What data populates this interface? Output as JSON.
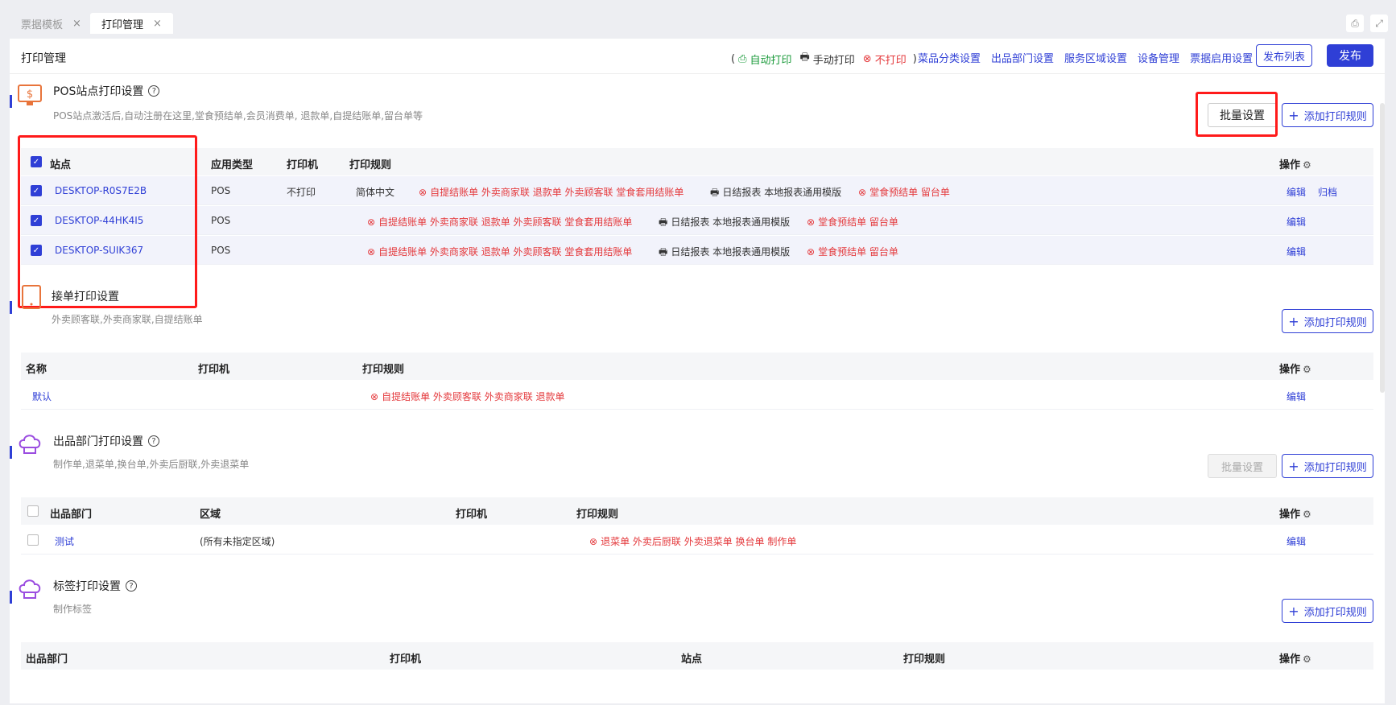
{
  "tabs": [
    {
      "label": "票据模板",
      "close": "×"
    },
    {
      "label": "打印管理",
      "close": "×"
    }
  ],
  "header": {
    "title": "打印管理",
    "legend": {
      "open": "(",
      "auto": "自动打印",
      "manual": "手动打印",
      "none": "不打印",
      "close": ")"
    },
    "links": [
      "菜品分类设置",
      "出品部门设置",
      "服务区域设置",
      "设备管理",
      "票据启用设置"
    ],
    "publish_list": "发布列表",
    "publish": "发布"
  },
  "pos": {
    "title": "POS站点打印设置",
    "desc": "POS站点激活后,自动注册在这里,堂食预结单,会员消费单, 退款单,自提结账单,留台单等",
    "batch": "批量设置",
    "add_rule": "添加打印规则",
    "columns": [
      "站点",
      "应用类型",
      "打印机",
      "打印规则",
      "操作"
    ],
    "rows": [
      {
        "site": "DESKTOP-R0S7E2B",
        "type": "POS",
        "printer": "不打印",
        "lang": "简体中文",
        "rule1": "自提结账单 外卖商家联 退款单 外卖顾客联 堂食套用结账单",
        "rule2": "日结报表 本地报表通用模版",
        "rule3": "堂食预结单 留台单",
        "edit": "编辑",
        "archive": "归档"
      },
      {
        "site": "DESKTOP-44HK4I5",
        "type": "POS",
        "printer": "",
        "lang": "",
        "rule1": "自提结账单 外卖商家联 退款单 外卖顾客联 堂食套用结账单",
        "rule2": "日结报表 本地报表通用模版",
        "rule3": "堂食预结单 留台单",
        "edit": "编辑",
        "archive": ""
      },
      {
        "site": "DESKTOP-SUIK367",
        "type": "POS",
        "printer": "",
        "lang": "",
        "rule1": "自提结账单 外卖商家联 退款单 外卖顾客联 堂食套用结账单",
        "rule2": "日结报表 本地报表通用模版",
        "rule3": "堂食预结单 留台单",
        "edit": "编辑",
        "archive": ""
      }
    ]
  },
  "order": {
    "title": "接单打印设置",
    "desc": "外卖顾客联,外卖商家联,自提结账单",
    "add_rule": "添加打印规则",
    "columns": [
      "名称",
      "打印机",
      "打印规则",
      "操作"
    ],
    "rows": [
      {
        "name": "默认",
        "printer": "",
        "rule": "自提结账单 外卖顾客联 外卖商家联 退款单",
        "edit": "编辑"
      }
    ]
  },
  "dept": {
    "title": "出品部门打印设置",
    "desc": "制作单,退菜单,换台单,外卖后厨联,外卖退菜单",
    "batch": "批量设置",
    "add_rule": "添加打印规则",
    "columns": [
      "出品部门",
      "区域",
      "打印机",
      "打印规则",
      "操作"
    ],
    "rows": [
      {
        "name": "测试",
        "area": "(所有未指定区域)",
        "printer": "",
        "rule": "退菜单 外卖后厨联 外卖退菜单 换台单 制作单",
        "edit": "编辑"
      }
    ]
  },
  "label": {
    "title": "标签打印设置",
    "desc": "制作标签",
    "add_rule": "添加打印规则",
    "columns": [
      "出品部门",
      "打印机",
      "站点",
      "打印规则",
      "操作"
    ]
  },
  "icons": {
    "help": "?",
    "gear": "⚙",
    "no_print": "⊗",
    "printer": "🖶",
    "plus": "+"
  },
  "colors": {
    "accent": "#2f3fd6",
    "danger": "#e4393c",
    "success": "#1a9a3a",
    "highlight": "#ff1a1a"
  }
}
